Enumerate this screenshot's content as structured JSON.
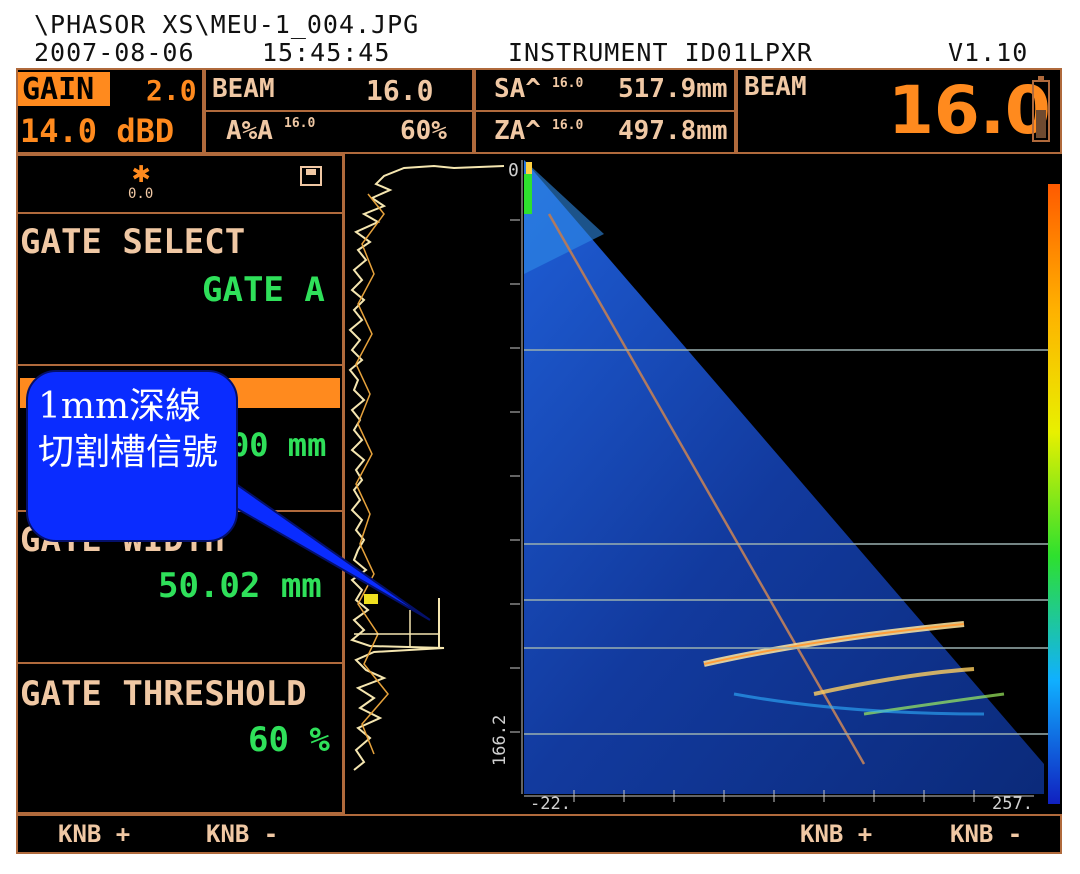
{
  "header": {
    "path": "\\PHASOR XS\\MEU-1_004.JPG",
    "date": "2007-08-06",
    "time": "15:45:45",
    "instrument": "INSTRUMENT ID01LPXR",
    "version": "V1.10"
  },
  "topbar": {
    "gain_label": "GAIN",
    "gain_step": "2.0",
    "gain_value": "14.0 dBD",
    "beam_label": "BEAM",
    "beam_value": "16.0",
    "aa_label": "A%A",
    "aa_sup": "16.0",
    "aa_value": "60%",
    "sa_label": "SA^",
    "sa_sup": "16.0",
    "sa_value": "517.9mm",
    "za_label": "ZA^",
    "za_sup": "16.0",
    "za_value": "497.8mm",
    "beam_big_label": "BEAM",
    "beam_big_value": "16.0"
  },
  "sidebar": {
    "star_value": "0.0",
    "gate_select_label": "GATE SELECT",
    "gate_select_value": "GATE A",
    "gate_start_value": "00 mm",
    "gate_width_label": "GATE WIDTH",
    "gate_width_value": "50.02 mm",
    "gate_threshold_label": "GATE THRESHOLD",
    "gate_threshold_value": "60 %"
  },
  "scan": {
    "depth_top": "0",
    "depth_bottom": "166.2",
    "x_left": "-22.",
    "x_right": "257."
  },
  "footer": {
    "knb_plus_1": "KNB +",
    "knb_minus_1": "KNB -",
    "knb_plus_2": "KNB +",
    "knb_minus_2": "KNB -"
  },
  "annotation": {
    "text": "1mm深線切割槽信號"
  },
  "colors": {
    "accent_orange": "#ff8a1e",
    "value_green": "#2fe05a",
    "frame_brown": "#b06a3c",
    "callout_blue": "#0a2cff"
  },
  "icons": [
    "asterisk-icon",
    "save-icon",
    "battery-icon"
  ]
}
